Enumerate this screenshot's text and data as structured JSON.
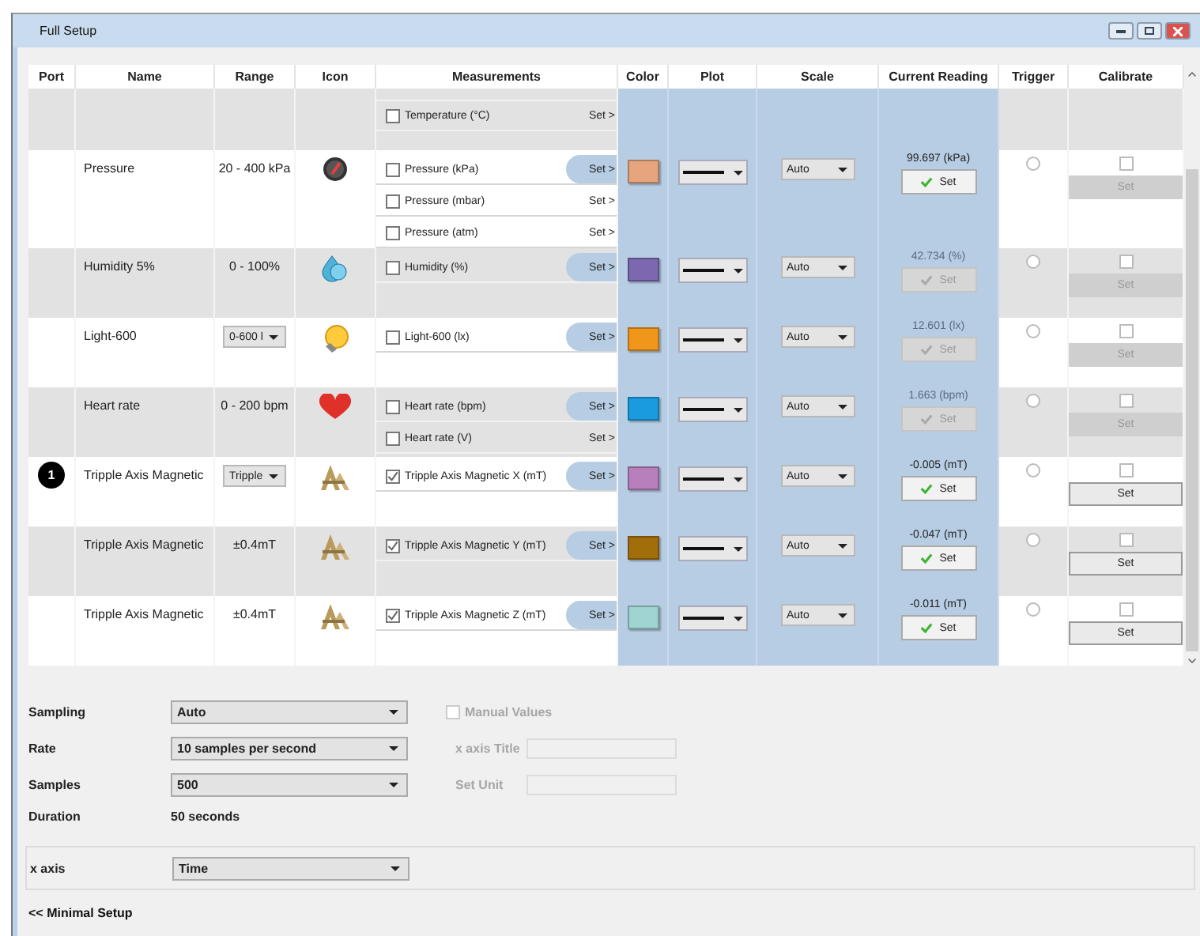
{
  "window": {
    "title": "Full Setup"
  },
  "table": {
    "columns": [
      "Port",
      "Name",
      "Range",
      "Icon",
      "Measurements",
      "Color",
      "Plot",
      "Scale",
      "Current Reading",
      "Trigger",
      "Calibrate"
    ],
    "rows": [
      {
        "cut_off_top": true,
        "measurements": [
          {
            "label": "Temperature (°C)",
            "checked": false,
            "selected": false,
            "set": "Set >"
          }
        ]
      },
      {
        "name": "Pressure",
        "range": {
          "kind": "text",
          "text": "20 - 400 kPa"
        },
        "kind": "gauge",
        "measurements": [
          {
            "label": "Pressure (kPa)",
            "checked": false,
            "selected": true,
            "set": "Set >"
          },
          {
            "label": "Pressure (mbar)",
            "checked": false,
            "selected": false,
            "set": "Set >"
          },
          {
            "label": "Pressure (atm)",
            "checked": false,
            "selected": false,
            "set": "Set >"
          }
        ],
        "color": "#e6a57e",
        "scale": "Auto",
        "reading": {
          "text": "99.697 (kPa)",
          "enabled": true,
          "button": "Set"
        },
        "trigger": {
          "selected": false
        },
        "calibrate": {
          "checked": false,
          "enabled": false,
          "button": "Set"
        }
      },
      {
        "name": "Humidity 5%",
        "range": {
          "kind": "text",
          "text": "0 - 100%"
        },
        "kind": "drops",
        "measurements": [
          {
            "label": "Humidity (%)",
            "checked": false,
            "selected": true,
            "set": "Set >"
          }
        ],
        "color": "#7c68b0",
        "scale": "Auto",
        "reading": {
          "text": "42.734 (%)",
          "enabled": false,
          "button": "Set"
        },
        "trigger": {
          "selected": false
        },
        "calibrate": {
          "checked": false,
          "enabled": false,
          "button": "Set"
        }
      },
      {
        "name": "Light-600",
        "range": {
          "kind": "dropdown",
          "text": "0-600 l"
        },
        "kind": "bulb",
        "measurements": [
          {
            "label": "Light-600 (lx)",
            "checked": false,
            "selected": true,
            "set": "Set >"
          }
        ],
        "color": "#f0961a",
        "scale": "Auto",
        "reading": {
          "text": "12.601 (lx)",
          "enabled": false,
          "button": "Set"
        },
        "trigger": {
          "selected": false
        },
        "calibrate": {
          "checked": false,
          "enabled": false,
          "button": "Set"
        }
      },
      {
        "name": "Heart rate",
        "range": {
          "kind": "text",
          "text": "0 - 200 bpm"
        },
        "kind": "heart",
        "measurements": [
          {
            "label": "Heart rate (bpm)",
            "checked": false,
            "selected": true,
            "set": "Set >"
          },
          {
            "label": "Heart rate (V)",
            "checked": false,
            "selected": false,
            "set": "Set >"
          }
        ],
        "color": "#1a9be0",
        "scale": "Auto",
        "reading": {
          "text": "1.663 (bpm)",
          "enabled": false,
          "button": "Set"
        },
        "trigger": {
          "selected": false
        },
        "calibrate": {
          "checked": false,
          "enabled": false,
          "button": "Set"
        }
      },
      {
        "port": "1",
        "name": "Tripple Axis Magnetic",
        "range": {
          "kind": "dropdown",
          "text": "Tripple"
        },
        "kind": "emblem",
        "measurements": [
          {
            "label": "Tripple Axis Magnetic X (mT)",
            "checked": true,
            "selected": true,
            "set": "Set >"
          }
        ],
        "color": "#b77fbb",
        "scale": "Auto",
        "reading": {
          "text": "-0.005 (mT)",
          "enabled": true,
          "button": "Set"
        },
        "trigger": {
          "selected": false
        },
        "calibrate": {
          "checked": false,
          "enabled": true,
          "button": "Set"
        }
      },
      {
        "name": "Tripple Axis Magnetic",
        "range": {
          "kind": "text",
          "text": "±0.4mT"
        },
        "kind": "emblem",
        "measurements": [
          {
            "label": "Tripple Axis Magnetic Y (mT)",
            "checked": true,
            "selected": true,
            "set": "Set >"
          }
        ],
        "color": "#a26e0c",
        "scale": "Auto",
        "reading": {
          "text": "-0.047 (mT)",
          "enabled": true,
          "button": "Set"
        },
        "trigger": {
          "selected": false
        },
        "calibrate": {
          "checked": false,
          "enabled": true,
          "button": "Set"
        }
      },
      {
        "name": "Tripple Axis Magnetic",
        "range": {
          "kind": "text",
          "text": "±0.4mT"
        },
        "kind": "emblem",
        "measurements": [
          {
            "label": "Tripple Axis Magnetic Z (mT)",
            "checked": true,
            "selected": true,
            "set": "Set >"
          }
        ],
        "color": "#9fd4d2",
        "scale": "Auto",
        "reading": {
          "text": "-0.011 (mT)",
          "enabled": true,
          "button": "Set"
        },
        "trigger": {
          "selected": false
        },
        "calibrate": {
          "checked": false,
          "enabled": true,
          "button": "Set"
        }
      }
    ]
  },
  "settings": {
    "sampling": {
      "label": "Sampling",
      "value": "Auto"
    },
    "rate": {
      "label": "Rate",
      "value": "10 samples per second"
    },
    "samples": {
      "label": "Samples",
      "value": "500"
    },
    "duration": {
      "label": "Duration",
      "value": "50 seconds"
    },
    "manual_values": {
      "label": "Manual Values",
      "checked": false,
      "disabled": true
    },
    "x_axis_title": {
      "label": "x axis Title",
      "disabled": true
    },
    "set_unit": {
      "label": "Set Unit",
      "disabled": true
    }
  },
  "x_axis": {
    "label": "x axis",
    "value": "Time"
  },
  "link": "<< Minimal Setup"
}
